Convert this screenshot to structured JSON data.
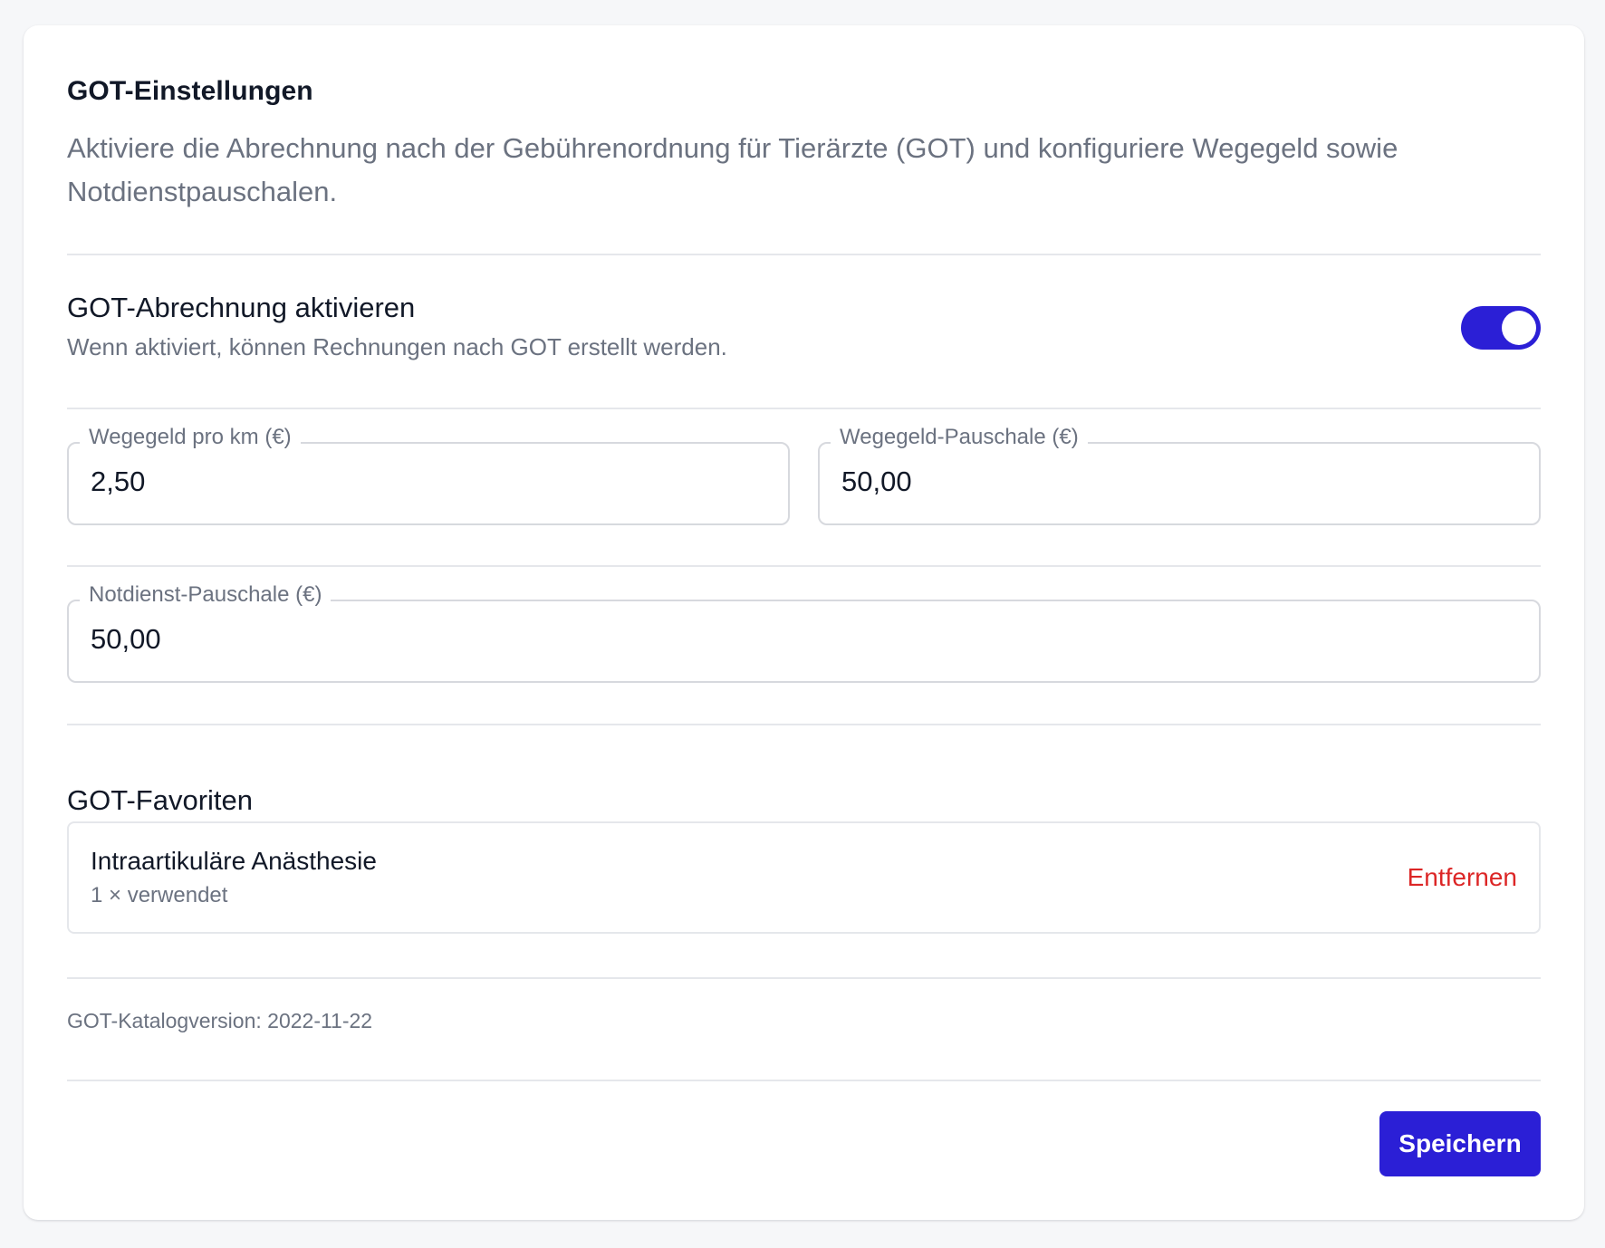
{
  "header": {
    "title": "GOT-Einstellungen",
    "description": "Aktiviere die Abrechnung nach der Gebührenordnung für Tierärzte (GOT) und konfiguriere Wegegeld sowie Notdienstpauschalen."
  },
  "billing_toggle": {
    "title": "GOT-Abrechnung aktivieren",
    "subtitle": "Wenn aktiviert, können Rechnungen nach GOT erstellt werden.",
    "enabled": true
  },
  "fields": {
    "travel_per_km": {
      "label": "Wegegeld pro km (€)",
      "value": "2,50"
    },
    "travel_flat": {
      "label": "Wegegeld-Pauschale (€)",
      "value": "50,00"
    },
    "emergency_flat": {
      "label": "Notdienst-Pauschale (€)",
      "value": "50,00"
    }
  },
  "favorites": {
    "title": "GOT-Favoriten",
    "items": [
      {
        "name": "Intraartikuläre Anästhesie",
        "usage": "1 × verwendet",
        "remove_label": "Entfernen"
      }
    ]
  },
  "catalog_version": "GOT-Katalogversion: 2022-11-22",
  "actions": {
    "save_label": "Speichern"
  },
  "colors": {
    "accent": "#2b1fd6",
    "danger": "#dc2626",
    "muted_text": "#6b7280",
    "border": "#e5e7eb"
  }
}
